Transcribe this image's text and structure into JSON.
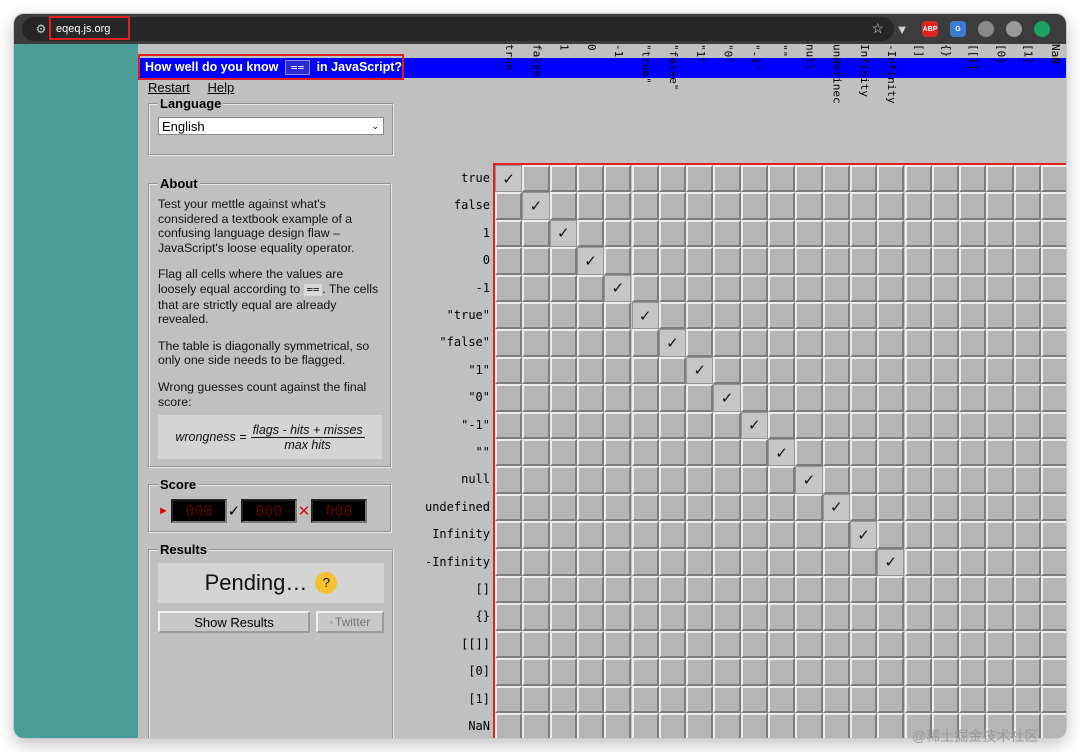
{
  "browser": {
    "url": "eqeq.js.org"
  },
  "page": {
    "title_before": "How well do you know",
    "title_code": "==",
    "title_after": "in JavaScript?",
    "menu": {
      "restart": "Restart",
      "help": "Help"
    }
  },
  "language": {
    "legend": "Language",
    "selected": "English"
  },
  "about": {
    "legend": "About",
    "p1": "Test your mettle against what's considered a textbook example of a confusing language design flaw – JavaScript's loose equality operator.",
    "p2_before": "Flag all cells where the values are loosely equal according to",
    "p2_code": "==",
    "p2_after": ". The cells that are strictly equal are already revealed.",
    "p3": "The table is diagonally symmetrical, so only one side needs to be flagged.",
    "p4": "Wrong guesses count against the final score:",
    "formula_lhs": "wrongness =",
    "formula_num": "flags - hits + misses",
    "formula_den": "max hits"
  },
  "score": {
    "legend": "Score",
    "counters": [
      "000",
      "000",
      "000"
    ],
    "arrow_icon": "arrow-right-icon",
    "check_icon": "check-icon",
    "cross_icon": "cross-icon"
  },
  "results": {
    "legend": "Results",
    "status": "Pending…",
    "status_emoji": "🤔",
    "show_results": "Show Results",
    "twitter": "Twitter"
  },
  "grid": {
    "values": [
      "true",
      "false",
      "1",
      "0",
      "-1",
      "\"true\"",
      "\"false\"",
      "\"1\"",
      "\"0\"",
      "\"-1\"",
      "\"\"",
      "null",
      "undefined",
      "Infinity",
      "-Infinity",
      "[]",
      "{}",
      "[[]]",
      "[0]",
      "[1]",
      "NaN"
    ],
    "column_labels": [
      "true",
      "false",
      "1",
      "0",
      "-1",
      "\"true\"",
      "\"false\"",
      "\"1\"",
      "\"0\"",
      "\"-1\"",
      "\"\"",
      "null",
      "undefinec",
      "Infinity",
      "-Infinity",
      "[]",
      "{}",
      "[[]]",
      "[0]",
      "[1]",
      "NaN"
    ],
    "revealed_mark": "✓",
    "revealed_count": 15
  },
  "watermark": "@稀土掘金技术社区"
}
